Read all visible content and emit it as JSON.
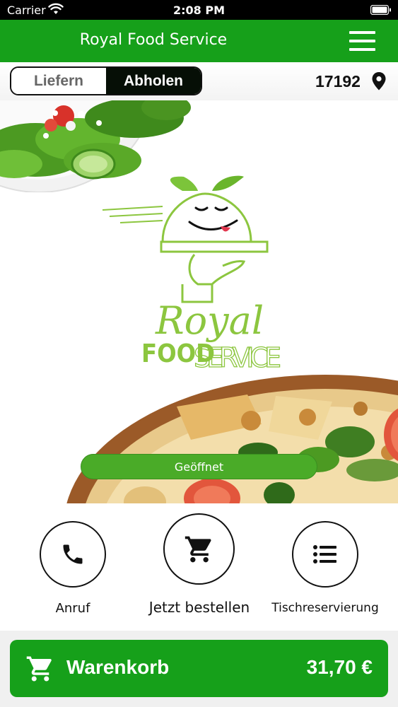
{
  "status_bar": {
    "carrier": "Carrier",
    "time": "2:08 PM",
    "icons": [
      "wifi-icon",
      "battery-icon"
    ]
  },
  "header": {
    "title": "Royal Food Service",
    "menu_icon": "hamburger-menu-icon",
    "background_color": "#16a01a"
  },
  "order_mode": {
    "options": [
      "Liefern",
      "Abholen"
    ],
    "selected": "Abholen",
    "postal_code": "17192",
    "location_icon": "map-pin-icon"
  },
  "hero": {
    "logo": {
      "line1": "Royal",
      "line2a": "FOOD",
      "line2b": "SERVICE",
      "color": "#8cc63f"
    },
    "status_badge": "Geöffnet",
    "badge_color": "#4aab28"
  },
  "actions": [
    {
      "label": "Anruf",
      "icon": "phone-icon"
    },
    {
      "label": "Jetzt bestellen",
      "icon": "shopping-cart-icon"
    },
    {
      "label": "Tischreservierung",
      "icon": "list-icon"
    }
  ],
  "cart": {
    "label": "Warenkorb",
    "total": "31,70 €",
    "icon": "shopping-cart-icon",
    "background_color": "#16a01a"
  }
}
